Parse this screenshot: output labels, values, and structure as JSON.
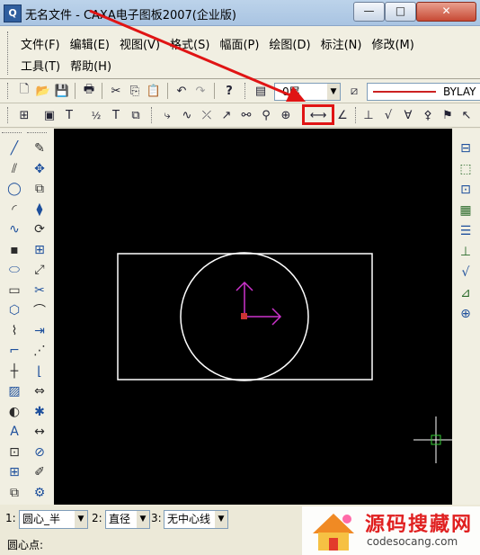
{
  "window": {
    "title": "无名文件 - CAXA电子图板2007(企业版)"
  },
  "menu": {
    "row1": [
      "文件(F)",
      "编辑(E)",
      "视图(V)",
      "格式(S)",
      "幅面(P)",
      "绘图(D)",
      "标注(N)",
      "修改(M)"
    ],
    "row2": [
      "工具(T)",
      "帮助(H)"
    ]
  },
  "toolbar": {
    "layer": "0层",
    "linetype": "BYLAY"
  },
  "commandbar": {
    "items": [
      {
        "num": "1:",
        "value": "圆心_半"
      },
      {
        "num": "2:",
        "value": "直径"
      },
      {
        "num": "3:",
        "value": "无中心线"
      }
    ],
    "prompt": "圆心点:"
  },
  "watermark": {
    "title": "源码搜藏网",
    "url": "codesocang.com"
  },
  "colors": {
    "canvas": "#000000",
    "axis": "#cc33cc",
    "highlight": "#e01414"
  },
  "icons": {
    "left_col1": [
      "line-icon",
      "parallel-line-icon",
      "circle-icon",
      "arc-icon",
      "spline-icon",
      "point-icon",
      "ellipse-icon",
      "rectangle-icon",
      "polygon-icon",
      "polyline-icon",
      "corner-line-icon",
      "centerline-icon",
      "hatch-icon",
      "fill-icon",
      "text-icon",
      "block-icon",
      "insert-image-icon",
      "object-icon"
    ],
    "left_col2": [
      "erase-icon",
      "move-icon",
      "copy-icon",
      "mirror-icon",
      "rotate-icon",
      "array-icon",
      "scale-icon",
      "trim-icon",
      "fillet-icon",
      "extend-icon",
      "break-icon",
      "chamfer-icon",
      "stretch-icon",
      "explode-icon",
      "lengthen-icon",
      "mask-icon",
      "edit-icon",
      "format-icon"
    ],
    "right_col": [
      "block-create-icon",
      "block-insert-icon",
      "drawing-icon",
      "library-icon",
      "properties-icon",
      "tolerance-icon",
      "roughness-icon",
      "weld-icon",
      "datum-icon"
    ]
  }
}
